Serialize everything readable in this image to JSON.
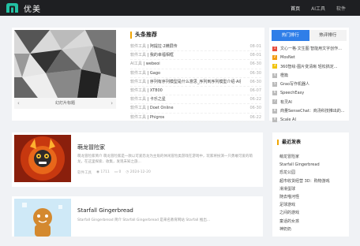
{
  "brand": {
    "name": "优美"
  },
  "nav": [
    {
      "label": "首页",
      "active": true
    },
    {
      "label": "AI工具",
      "active": false
    },
    {
      "label": "软件",
      "active": false
    }
  ],
  "slider": {
    "caption": "幻灯片标题",
    "prev": "‹",
    "next": "›"
  },
  "headlines": {
    "title": "头条推荐",
    "items": [
      {
        "category": "软件工具",
        "text": "阿提拉·2横屏传",
        "date": "08-01"
      },
      {
        "category": "软件工具",
        "text": "我的幸福相框",
        "date": "08-01"
      },
      {
        "category": "AI工具",
        "text": "webeoi",
        "date": "06-30"
      },
      {
        "category": "软件工具",
        "text": "Gago",
        "date": "06-30"
      },
      {
        "category": "软件工具",
        "text": "序列有序列模型是什么意思_序列到序列模型介绍·AI探识",
        "date": "06-30"
      },
      {
        "category": "软件工具",
        "text": "XT800",
        "date": "06-07"
      },
      {
        "category": "软件工具",
        "text": "卡乐之星",
        "date": "06-22"
      },
      {
        "category": "软件工具",
        "text": "Doet Online",
        "date": "06-30"
      },
      {
        "category": "软件工具",
        "text": "Phigros",
        "date": "06-22"
      }
    ]
  },
  "ranking": {
    "tabs": [
      {
        "label": "热门排行",
        "active": true
      },
      {
        "label": "热评排行",
        "active": false
      }
    ],
    "items": [
      {
        "num": "1",
        "text": "文心一格·文生图 智能用文字创作..."
      },
      {
        "num": "2",
        "text": "MosNet"
      },
      {
        "num": "3",
        "text": "360智绘·图片变清晰 轻松搞定..."
      },
      {
        "num": "4",
        "text": "橙篇"
      },
      {
        "num": "5",
        "text": "Grao写作机器人"
      },
      {
        "num": "6",
        "text": "SpeechEasy"
      },
      {
        "num": "7",
        "text": "有灵AI"
      },
      {
        "num": "8",
        "text": "商量SenseChat：商汤科技推出的..."
      },
      {
        "num": "9",
        "text": "Scale AI"
      }
    ]
  },
  "articles": [
    {
      "title": "萌龙冒险家",
      "desc": "萌龙冒险家简介 萌龙冒险家是一款以可爱恐龙为主角的休闲冒险类游戏在游戏中，玩家将扮演一只勇敢可爱的萌龙，在这里探索、收集，发现未知之旅...",
      "category": "软件工具",
      "views": "1711",
      "comments": "0",
      "date": "2024-12-20"
    },
    {
      "title": "Starfall Gingerbread",
      "desc": "Starfall Gingerbread 简介 Starfall Gingerbread 是来名教育网站 Starfall 推出...",
      "category": "",
      "views": "",
      "comments": "",
      "date": ""
    }
  ],
  "latest": {
    "title": "最近发表",
    "items": [
      "萌龙冒险家",
      "Starfall Gingerbread",
      "恐龙公园",
      "超市收货经营 3D：购物游戏",
      "滑滑蛋球",
      "随去喵河怪",
      "足球游戏",
      "之间的游戏",
      "童话的女孩",
      "神奶奶"
    ]
  }
}
